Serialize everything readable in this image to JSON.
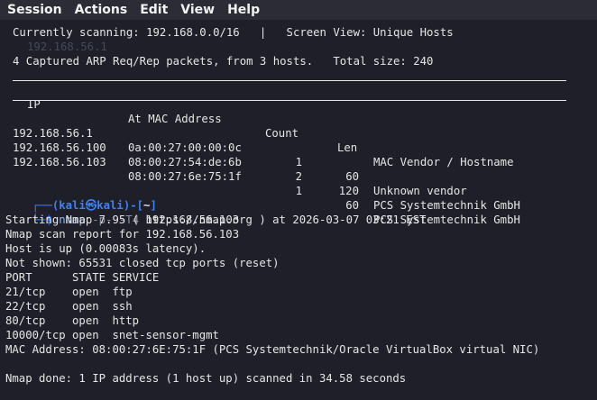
{
  "menu": [
    "Session",
    "Actions",
    "Edit",
    "View",
    "Help"
  ],
  "netdiscover": {
    "scan_line": "Currently scanning: 192.168.0.0/16   |   Screen View: Unique Hosts",
    "ghost_text": "192.168.56.1",
    "summary": "4 Captured ARP Req/Rep packets, from 3 hosts.   Total size: 240",
    "headers": [
      "IP",
      "At MAC Address",
      "Count",
      "Len",
      "MAC Vendor / Hostname"
    ],
    "rows": [
      [
        "192.168.56.1",
        "0a:00:27:00:00:0c",
        "1",
        "60",
        "Unknown vendor"
      ],
      [
        "192.168.56.100",
        "08:00:27:54:de:6b",
        "2",
        "120",
        "PCS Systemtechnik GmbH"
      ],
      [
        "192.168.56.103",
        "08:00:27:6e:75:1f",
        "1",
        "60",
        "PCS Systemtechnik GmbH"
      ]
    ]
  },
  "prompt": {
    "corner_top": "┌──(",
    "user": "kali",
    "at": "㉿",
    "host": "kali",
    "path_open": ")-[",
    "path": "~",
    "path_close": "]",
    "corner_bottom": "└─",
    "dollar": "$",
    "command": "nmap",
    "args": "-p- -T4",
    "target": "192.168.56.103"
  },
  "output": [
    "Starting Nmap 7.95 ( https://nmap.org ) at 2026-03-07 03:21 EST",
    "Nmap scan report for 192.168.56.103",
    "Host is up (0.00083s latency).",
    "Not shown: 65531 closed tcp ports (reset)",
    "PORT      STATE SERVICE",
    "21/tcp    open  ftp",
    "22/tcp    open  ssh",
    "80/tcp    open  http",
    "10000/tcp open  snet-sensor-mgmt",
    "MAC Address: 08:00:27:6E:75:1F (PCS Systemtechnik/Oracle VirtualBox virtual NIC)",
    "",
    "Nmap done: 1 IP address (1 host up) scanned in 34.58 seconds"
  ],
  "colors": {
    "background": "#1e1f29",
    "menubar": "#2b2c35",
    "prompt_blue": "#3b82f6"
  }
}
